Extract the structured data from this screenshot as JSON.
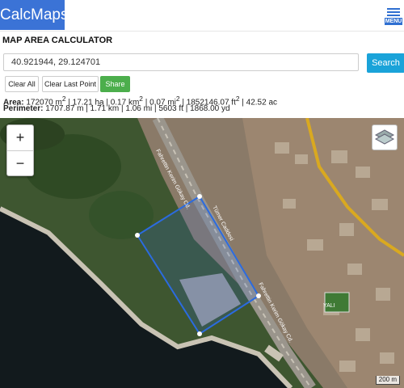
{
  "app": {
    "logo_text": "CalcMaps",
    "menu_label": "MENU",
    "page_title": "MAP AREA CALCULATOR"
  },
  "search": {
    "value": "40.921944, 29.124701",
    "button_label": "Search"
  },
  "actions": {
    "clear_all": "Clear All",
    "clear_last": "Clear Last Point",
    "share": "Share"
  },
  "results": {
    "area_label": "Area:",
    "area_m2": "172070 m",
    "area_ha": "| 17.21 ha | 0.17 km",
    "area_mi2": "| 0.07 mi",
    "area_ft2": "| 1852146.07 ft",
    "area_ac": "| 42.52 ac",
    "sup2": "2",
    "perimeter_label": "Perimeter:",
    "perimeter_values": "1707.87 m | 1.71 km | 1.06 mi | 5603 ft | 1868.00 yd"
  },
  "map": {
    "zoom_in": "+",
    "zoom_out": "−",
    "scale_label": "200 m",
    "street_label_1": "Fahrettin Kerim Gökay Cd.",
    "street_label_2": "Tümer Caddesi",
    "street_label_3": "Fahrettin Kerim Gökay Cd.",
    "poi_label": "YALI",
    "polygon_color": "#2b6be0"
  },
  "icons": {
    "menu": "hamburger-icon",
    "layers": "layers-icon"
  }
}
